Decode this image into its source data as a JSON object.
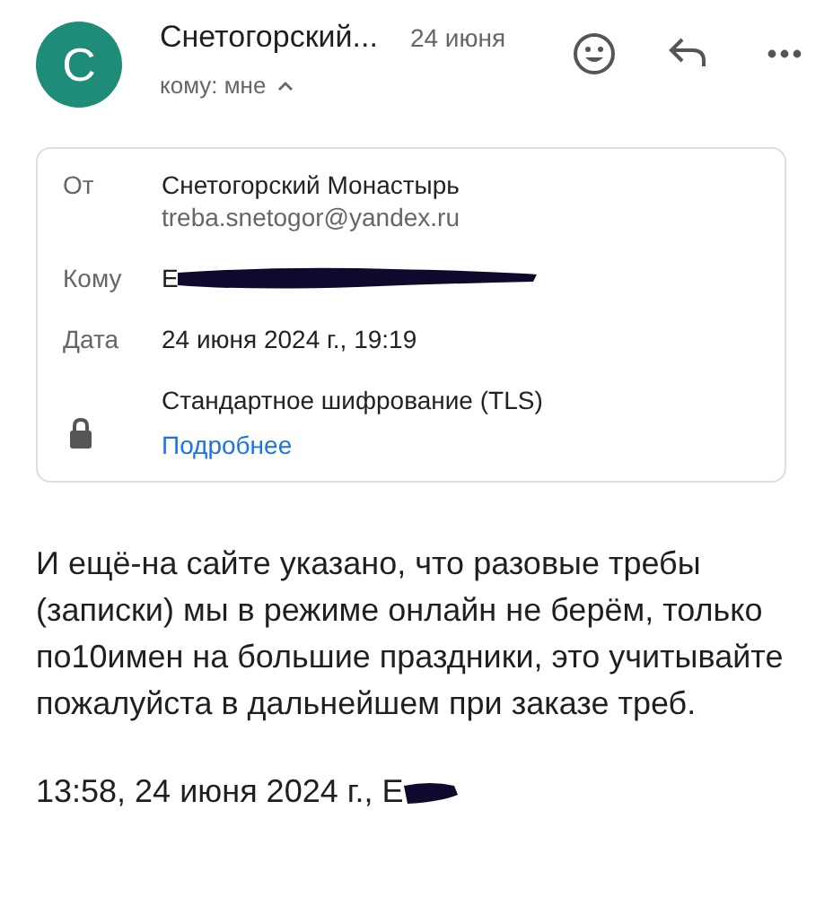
{
  "header": {
    "avatar_letter": "С",
    "sender": "Снетогорский...",
    "date": "24 июня",
    "recipients": "кому: мне",
    "details_expanded": true
  },
  "details": {
    "rows": [
      {
        "kind": "from",
        "label": "От",
        "value": "Снетогорский Монастырь",
        "sub": "treba.snetogor@yandex.ru"
      },
      {
        "kind": "redacted",
        "label": "Кому",
        "value": "Е"
      },
      {
        "kind": "plain",
        "label": "Дата",
        "value": "24 июня 2024 г., 19:19"
      },
      {
        "kind": "security",
        "value": "Стандартное шифрование (TLS)",
        "link": "Подробнее"
      }
    ]
  },
  "body": "И ещё-на сайте указано, что разовые требы (записки) мы в режиме онлайн не берём, только по10имен на большие праздники, это учитывайте пожалуйста в дальнейшем при заказе треб.",
  "quote_line": "13:58, 24 июня 2024 г., Е"
}
